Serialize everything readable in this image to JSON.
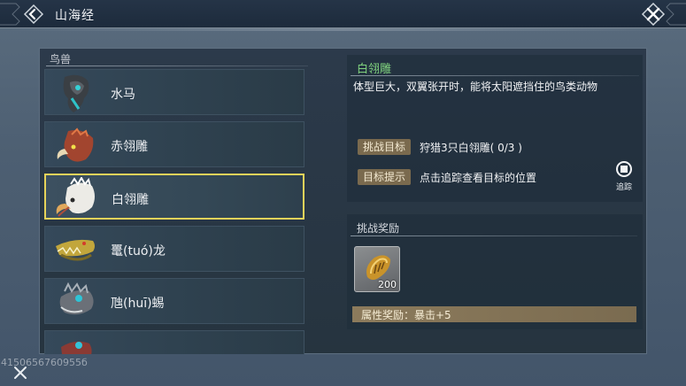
{
  "header": {
    "title": "山海经",
    "back_icon": "back-arrow-icon",
    "close_icon": "close-icon"
  },
  "list": {
    "header": "鸟兽",
    "items": [
      {
        "label": "水马",
        "icon": "water-horse-portrait",
        "selected": false
      },
      {
        "label": "赤翎雕",
        "icon": "red-eagle-portrait",
        "selected": false
      },
      {
        "label": "白翎雕",
        "icon": "white-eagle-portrait",
        "selected": true
      },
      {
        "label": "鼍(tuó)龙",
        "icon": "crocodile-dragon-portrait",
        "selected": false
      },
      {
        "label": "虺(huī)蜴",
        "icon": "lizard-portrait",
        "selected": false
      },
      {
        "label": "…",
        "icon": "partial-portrait",
        "selected": false
      }
    ]
  },
  "detail": {
    "title": "白翎雕",
    "description": "体型巨大，双翼张开时，能将太阳遮挡住的鸟类动物",
    "challenge_label": "挑战目标",
    "challenge_value": "狩猎3只白翎雕( 0/3 )",
    "hint_label": "目标提示",
    "hint_value": "点击追踪查看目标的位置",
    "track_label": "追踪"
  },
  "reward": {
    "title": "挑战奖励",
    "item_icon": "shell-item-icon",
    "item_count": "200",
    "attribute": "属性奖励：暴击+5"
  },
  "footer": {
    "uid": "4150656760955б"
  },
  "colors": {
    "selected_border": "#e7d35a",
    "detail_title": "#7fd27d",
    "tag_bg": "#7a6a4e"
  }
}
